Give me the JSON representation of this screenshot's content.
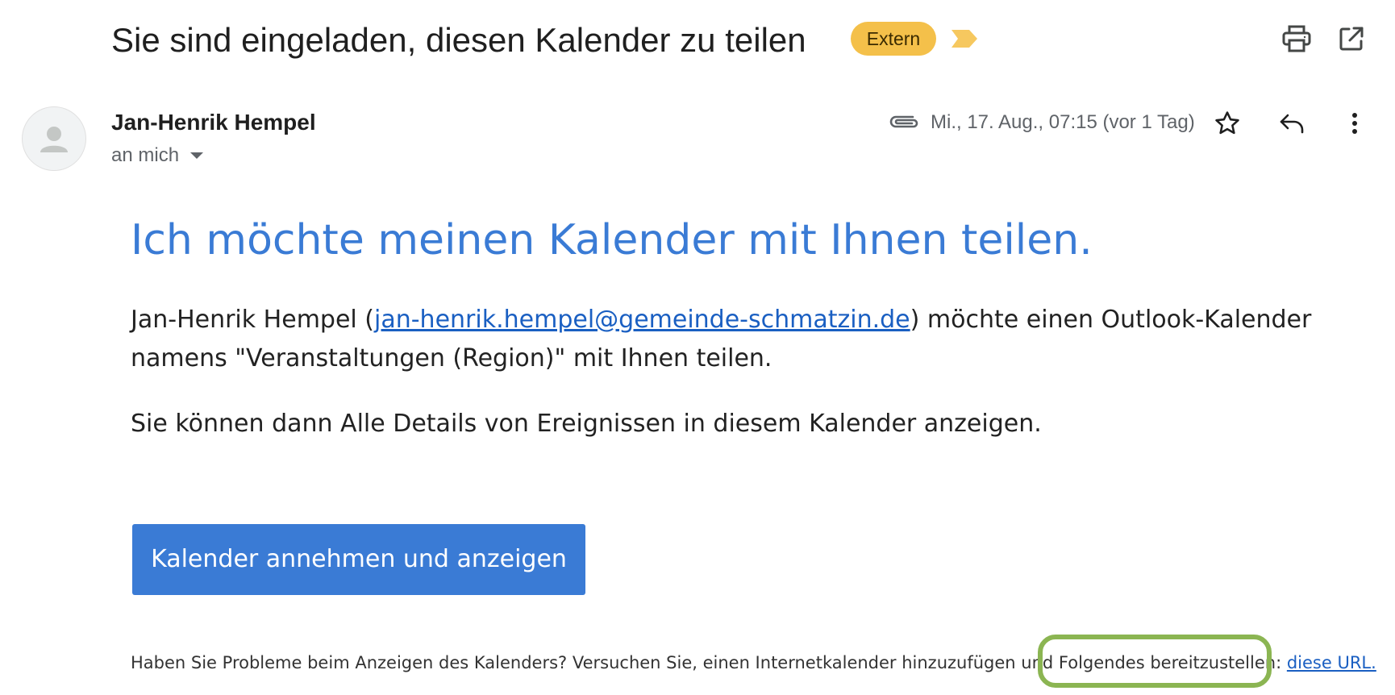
{
  "email": {
    "subject": "Sie sind eingeladen, diesen Kalender zu teilen",
    "label_badge": "Extern",
    "colors": {
      "badge_bg": "#f4c04a",
      "importance_marker": "#f6c85f",
      "heading_blue": "#3a7bd5",
      "link_blue": "#1a5fc2",
      "highlight_green": "#8bb552"
    },
    "toolbar": {
      "print_icon": "print-icon",
      "popout_icon": "open-in-new-window-icon"
    },
    "sender": {
      "name": "Jan-Henrik Hempel",
      "recipient_label": "an mich",
      "date": "Mi., 17. Aug., 07:15 (vor 1 Tag)"
    },
    "row_actions": {
      "attachment_icon": "paperclip-icon",
      "star_icon": "star-icon",
      "reply_icon": "reply-icon",
      "more_icon": "more-vertical-icon"
    }
  },
  "body": {
    "heading": "Ich möchte meinen Kalender mit Ihnen teilen.",
    "para1_pre": "Jan-Henrik Hempel (",
    "para1_email": "jan-henrik.hempel@gemeinde-schmatzin.de",
    "para1_post": ") möchte einen Outlook-Kalender namens \"Veranstaltungen (Region)\" mit Ihnen teilen.",
    "para2": "Sie können dann Alle Details von Ereignissen in diesem Kalender anzeigen.",
    "cta_label": "Kalender annehmen und anzeigen",
    "footer_text": "Haben Sie Probleme beim Anzeigen des Kalenders? Versuchen Sie, einen Internetkalender hinzuzufügen und Folgendes bereitzustellen: ",
    "footer_link": "diese URL."
  }
}
